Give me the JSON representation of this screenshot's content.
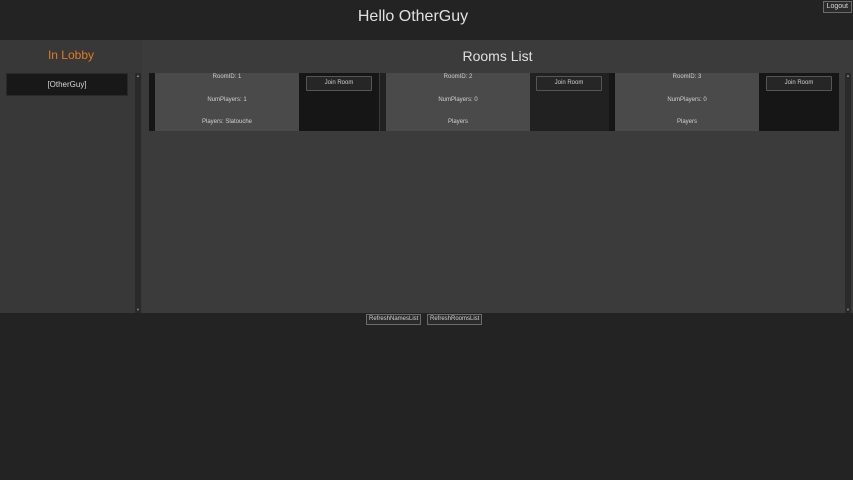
{
  "header": {
    "greeting": "Hello OtherGuy",
    "logout_label": "Logout"
  },
  "lobby": {
    "title": "In Lobby",
    "names": [
      "[OtherGuy]"
    ]
  },
  "rooms": {
    "title": "Rooms List",
    "items": [
      {
        "room_id": "RoomID: 1",
        "num_players": "NumPlayers: 1",
        "players": "Players: Slatouche",
        "join_label": "Join Room"
      },
      {
        "room_id": "RoomID: 2",
        "num_players": "NumPlayers: 0",
        "players": "Players",
        "join_label": "Join Room"
      },
      {
        "room_id": "RoomID: 3",
        "num_players": "NumPlayers: 0",
        "players": "Players",
        "join_label": "Join Room"
      }
    ]
  },
  "footer": {
    "refresh_names_label": "RefreshNamesList",
    "refresh_rooms_label": "RefreshRoomsList"
  },
  "scroll_arrows": {
    "up": "▲",
    "down": "▼"
  },
  "colors": {
    "background": "#232323",
    "lobby_panel": "#383838",
    "rooms_panel": "#3b3b3b",
    "lobby_title": "#e07a1f",
    "room_info": "#4a4a4a",
    "room_slot": "#161616"
  }
}
